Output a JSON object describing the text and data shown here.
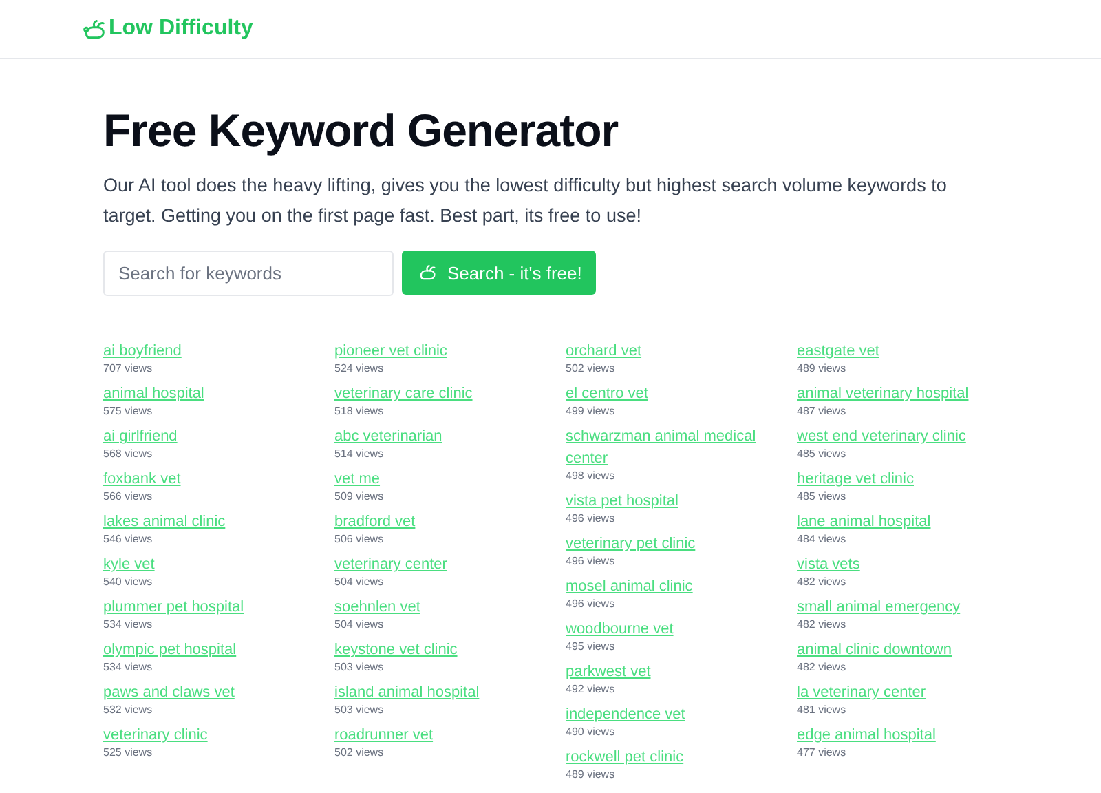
{
  "header": {
    "brand": "Low Difficulty"
  },
  "hero": {
    "title": "Free Keyword Generator",
    "description": "Our AI tool does the heavy lifting, gives you the lowest difficulty but highest search volume keywords to target. Getting you on the first page fast. Best part, its free to use!"
  },
  "search": {
    "placeholder": "Search for keywords",
    "button": "Search - it's free!"
  },
  "keyword_columns": [
    [
      {
        "keyword": "ai boyfriend",
        "views": "707 views"
      },
      {
        "keyword": "animal hospital",
        "views": "575 views"
      },
      {
        "keyword": "ai girlfriend",
        "views": "568 views"
      },
      {
        "keyword": "foxbank vet",
        "views": "566 views"
      },
      {
        "keyword": "lakes animal clinic",
        "views": "546 views"
      },
      {
        "keyword": "kyle vet",
        "views": "540 views"
      },
      {
        "keyword": "plummer pet hospital",
        "views": "534 views"
      },
      {
        "keyword": "olympic pet hospital",
        "views": "534 views"
      },
      {
        "keyword": "paws and claws vet",
        "views": "532 views"
      },
      {
        "keyword": "veterinary clinic",
        "views": "525 views"
      }
    ],
    [
      {
        "keyword": "pioneer vet clinic",
        "views": "524 views"
      },
      {
        "keyword": "veterinary care clinic",
        "views": "518 views"
      },
      {
        "keyword": "abc veterinarian",
        "views": "514 views"
      },
      {
        "keyword": "vet me",
        "views": "509 views"
      },
      {
        "keyword": "bradford vet",
        "views": "506 views"
      },
      {
        "keyword": "veterinary center",
        "views": "504 views"
      },
      {
        "keyword": "soehnlen vet",
        "views": "504 views"
      },
      {
        "keyword": "keystone vet clinic",
        "views": "503 views"
      },
      {
        "keyword": "island animal hospital",
        "views": "503 views"
      },
      {
        "keyword": "roadrunner vet",
        "views": "502 views"
      }
    ],
    [
      {
        "keyword": "orchard vet",
        "views": "502 views"
      },
      {
        "keyword": "el centro vet",
        "views": "499 views"
      },
      {
        "keyword": "schwarzman animal medical center",
        "views": "498 views"
      },
      {
        "keyword": "vista pet hospital",
        "views": "496 views"
      },
      {
        "keyword": "veterinary pet clinic",
        "views": "496 views"
      },
      {
        "keyword": "mosel animal clinic",
        "views": "496 views"
      },
      {
        "keyword": "woodbourne vet",
        "views": "495 views"
      },
      {
        "keyword": "parkwest vet",
        "views": "492 views"
      },
      {
        "keyword": "independence vet",
        "views": "490 views"
      },
      {
        "keyword": "rockwell pet clinic",
        "views": "489 views"
      }
    ],
    [
      {
        "keyword": "eastgate vet",
        "views": "489 views"
      },
      {
        "keyword": "animal veterinary hospital",
        "views": "487 views"
      },
      {
        "keyword": "west end veterinary clinic",
        "views": "485 views"
      },
      {
        "keyword": "heritage vet clinic",
        "views": "485 views"
      },
      {
        "keyword": "lane animal hospital",
        "views": "484 views"
      },
      {
        "keyword": "vista vets",
        "views": "482 views"
      },
      {
        "keyword": "small animal emergency",
        "views": "482 views"
      },
      {
        "keyword": "animal clinic downtown",
        "views": "482 views"
      },
      {
        "keyword": "la veterinary center",
        "views": "481 views"
      },
      {
        "keyword": "edge animal hospital",
        "views": "477 views"
      }
    ]
  ]
}
